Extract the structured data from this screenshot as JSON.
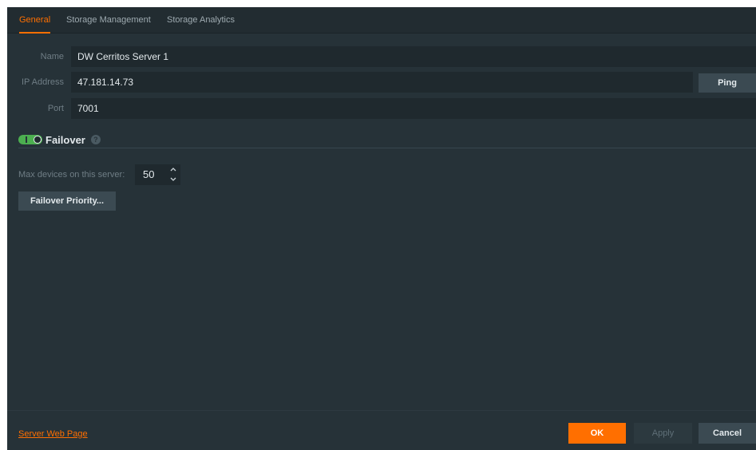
{
  "tabs": [
    {
      "label": "General",
      "active": true
    },
    {
      "label": "Storage Management",
      "active": false
    },
    {
      "label": "Storage Analytics",
      "active": false
    }
  ],
  "form": {
    "name_label": "Name",
    "name_value": "DW Cerritos Server 1",
    "ip_label": "IP Address",
    "ip_value": "47.181.14.73",
    "ping_label": "Ping",
    "port_label": "Port",
    "port_value": "7001"
  },
  "failover": {
    "enabled": true,
    "title": "Failover",
    "help_icon": "question-circle-icon",
    "max_devices_label": "Max devices on this server:",
    "max_devices_value": "50",
    "priority_button_label": "Failover Priority..."
  },
  "footer": {
    "link_label": "Server Web Page",
    "ok_label": "OK",
    "apply_label": "Apply",
    "cancel_label": "Cancel"
  },
  "colors": {
    "accent": "#ff6f00",
    "background": "#263238",
    "field_background": "#1f292e",
    "toggle_on": "#4caf50"
  }
}
